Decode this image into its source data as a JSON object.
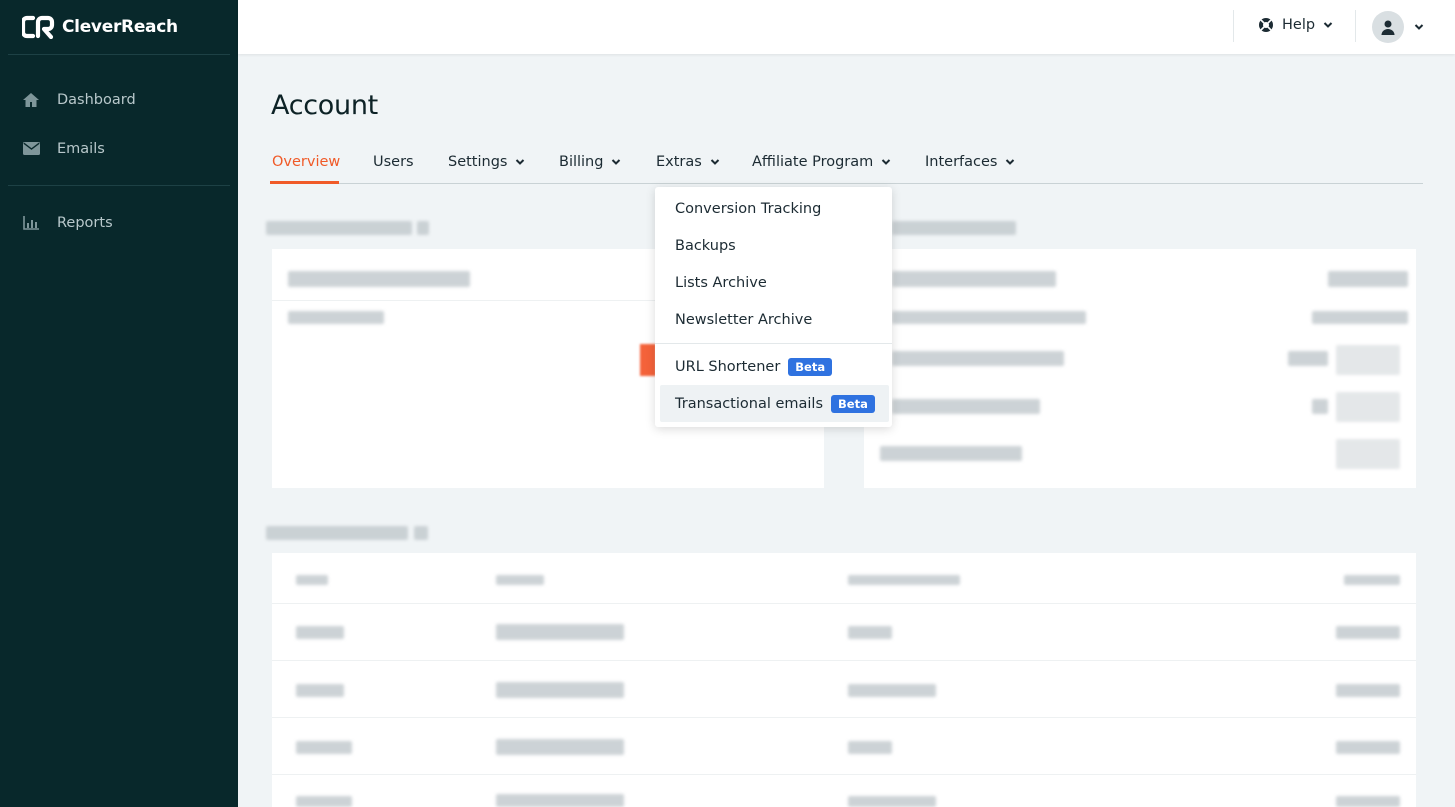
{
  "brand": {
    "name": "CleverReach",
    "accent": "#f05a28",
    "sidebar_bg": "#08282b",
    "badge": "#2f72e0"
  },
  "sidebar": {
    "items": [
      {
        "label": "Dashboard",
        "icon": "home-icon"
      },
      {
        "label": "Emails",
        "icon": "envelope-icon"
      },
      {
        "label": "Reports",
        "icon": "bar-chart-icon"
      }
    ]
  },
  "header": {
    "help_label": "Help",
    "help_icon": "lifebuoy-icon",
    "user_icon": "user-icon"
  },
  "page": {
    "title": "Account",
    "tabs": [
      {
        "label": "Overview",
        "active": true
      },
      {
        "label": "Users"
      },
      {
        "label": "Settings",
        "dropdown": true
      },
      {
        "label": "Billing",
        "dropdown": true
      },
      {
        "label": "Extras",
        "dropdown": true,
        "open": true
      },
      {
        "label": "Affiliate Program",
        "dropdown": true
      },
      {
        "label": "Interfaces",
        "dropdown": true
      }
    ]
  },
  "extras_menu": {
    "items": [
      {
        "label": "Conversion Tracking"
      },
      {
        "label": "Backups"
      },
      {
        "label": "Lists Archive"
      },
      {
        "label": "Newsletter Archive"
      },
      {
        "label": "URL Shortener",
        "badge": "Beta"
      },
      {
        "label": "Transactional emails",
        "badge": "Beta",
        "hovered": true
      }
    ]
  }
}
